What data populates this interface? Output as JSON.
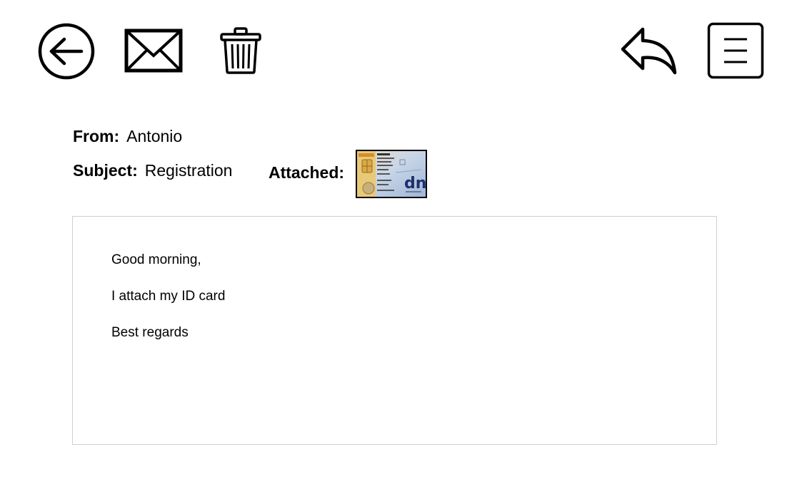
{
  "toolbar": {
    "back_icon": "back-arrow-circle-icon",
    "mail_icon": "envelope-icon",
    "delete_icon": "trash-icon",
    "reply_icon": "reply-arrow-icon",
    "menu_icon": "hamburger-menu-icon"
  },
  "email": {
    "from_label": "From:",
    "from_value": "Antonio",
    "subject_label": "Subject:",
    "subject_value": "Registration",
    "attached_label": "Attached:",
    "attachment": {
      "icon": "id-card-thumbnail",
      "logo_text": "dni"
    },
    "body": [
      "Good morning,",
      "I attach my ID card",
      "Best regards"
    ]
  }
}
